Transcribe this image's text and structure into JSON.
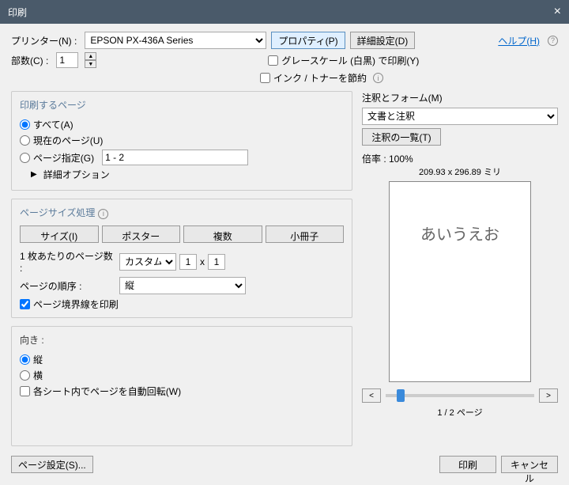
{
  "title": "印刷",
  "help_link": "ヘルプ(H)",
  "top": {
    "printer_label": "プリンター(N) :",
    "printer_value": "EPSON PX-436A Series",
    "properties_btn": "プロパティ(P)",
    "advanced_btn": "詳細設定(D)",
    "copies_label": "部数(C) :",
    "copies_value": "1",
    "grayscale_label": "グレースケール (白黒) で印刷(Y)",
    "savetoner_label": "インク / トナーを節約"
  },
  "range": {
    "title": "印刷するページ",
    "all": "すべて(A)",
    "current": "現在のページ(U)",
    "pages": "ページ指定(G)",
    "pages_value": "1 - 2",
    "more": "詳細オプション"
  },
  "size": {
    "title": "ページサイズ処理",
    "size_btn": "サイズ(I)",
    "poster_btn": "ポスター",
    "multi_btn": "複数",
    "booklet_btn": "小冊子",
    "perpage_label": "1 枚あたりのページ数 :",
    "perpage_value": "カスタム...",
    "by1": "1",
    "x": "x",
    "by2": "1",
    "order_label": "ページの順序 :",
    "order_value": "縦",
    "border_label": "ページ境界線を印刷"
  },
  "orient": {
    "title": "向き :",
    "portrait": "縦",
    "landscape": "横",
    "autorotate": "各シート内でページを自動回転(W)"
  },
  "comments": {
    "title": "注釈とフォーム(M)",
    "value": "文書と注釈",
    "list_btn": "注釈の一覧(T)"
  },
  "preview": {
    "zoom_label": "倍率 : 100%",
    "dim": "209.93 x 296.89 ミリ",
    "page_text": "あいうえお",
    "nav_prev": "<",
    "nav_next": ">",
    "page_count": "1 / 2 ページ"
  },
  "footer": {
    "page_setup": "ページ設定(S)...",
    "print": "印刷",
    "cancel": "キャンセル"
  }
}
